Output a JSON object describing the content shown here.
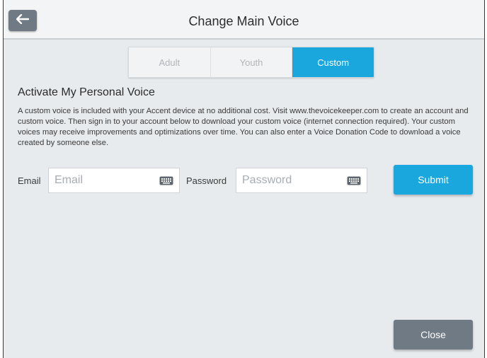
{
  "header": {
    "title": "Change Main Voice"
  },
  "tabs": [
    {
      "label": "Adult",
      "active": false
    },
    {
      "label": "Youth",
      "active": false
    },
    {
      "label": "Custom",
      "active": true
    }
  ],
  "section": {
    "heading": "Activate My Personal Voice",
    "description": "A custom voice is included with your Accent device at no additional cost. Visit www.thevoicekeeper.com to create an account and custom voice. Then sign in to your account below to download your custom voice (internet connection required). Your custom voices may receive improvements and optimizations over time. You can also enter a Voice Donation Code to download a voice created by someone else."
  },
  "form": {
    "email_label": "Email",
    "email_placeholder": "Email",
    "email_value": "",
    "password_label": "Password",
    "password_placeholder": "Password",
    "password_value": "",
    "submit_label": "Submit"
  },
  "footer": {
    "close_label": "Close"
  },
  "colors": {
    "accent": "#1aa7dd",
    "secondary_button": "#6f7a84",
    "background": "#e8ebee"
  },
  "icons": {
    "back": "arrow-left-icon",
    "keyboard": "keyboard-icon"
  }
}
